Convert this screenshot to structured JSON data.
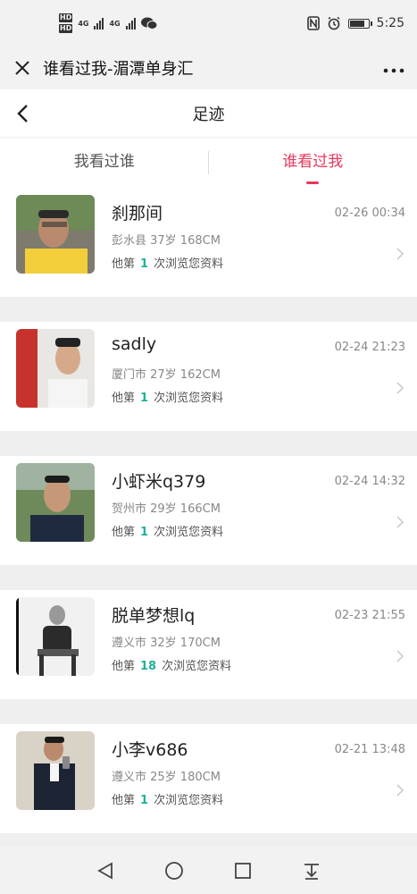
{
  "status": {
    "time": "5:25",
    "net_a": "4G",
    "net_b": "4G",
    "hd": "HD"
  },
  "window": {
    "title": "谁看过我-湄潭单身汇"
  },
  "nav": {
    "title": "足迹"
  },
  "tabs": [
    {
      "label": "我看过谁",
      "active": false
    },
    {
      "label": "谁看过我",
      "active": true
    }
  ],
  "colors": {
    "accent": "#e8385c",
    "count": "#1fb29a"
  },
  "visitors": [
    {
      "name": "刹那间",
      "time": "02-26 00:34",
      "info": "彭水县 37岁 168CM",
      "views_prefix": "他第",
      "views_count": "1",
      "views_suffix": "次浏览您资料"
    },
    {
      "name": "sadly",
      "time": "02-24 21:23",
      "info": "厦门市 27岁 162CM",
      "views_prefix": "他第",
      "views_count": "1",
      "views_suffix": "次浏览您资料"
    },
    {
      "name": "小虾米q379",
      "time": "02-24 14:32",
      "info": "贺州市 29岁 166CM",
      "views_prefix": "他第",
      "views_count": "1",
      "views_suffix": "次浏览您资料"
    },
    {
      "name": "脱单梦想lq",
      "time": "02-23 21:55",
      "info": "遵义市 32岁 170CM",
      "views_prefix": "他第",
      "views_count": "18",
      "views_suffix": "次浏览您资料"
    },
    {
      "name": "小李v686",
      "time": "02-21 13:48",
      "info": "遵义市 25岁 180CM",
      "views_prefix": "他第",
      "views_count": "1",
      "views_suffix": "次浏览您资料"
    }
  ]
}
